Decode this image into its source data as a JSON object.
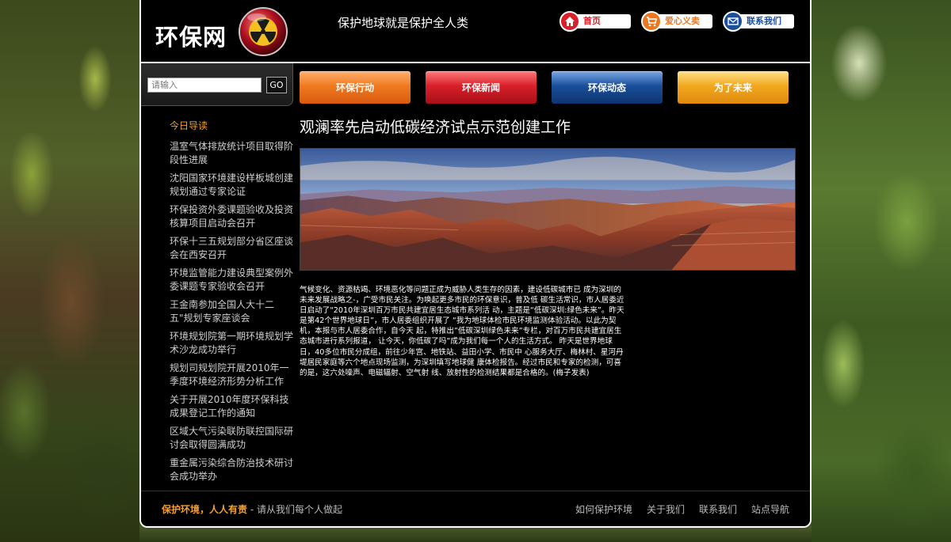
{
  "header": {
    "logo_text": "环保网",
    "slogan": "保护地球就是保护全人类",
    "topnav": [
      {
        "label": "首页",
        "icon": "home-icon",
        "color": "#d8202a"
      },
      {
        "label": "爱心义卖",
        "icon": "cart-icon",
        "color": "#e87822"
      },
      {
        "label": "联系我们",
        "icon": "mail-icon",
        "color": "#1a4f9a"
      }
    ]
  },
  "search": {
    "placeholder": "请输入",
    "button_label": "GO"
  },
  "mainnav": [
    {
      "label": "环保行动",
      "color": "#f07a20"
    },
    {
      "label": "环保新闻",
      "color": "#d8202a"
    },
    {
      "label": "环保动态",
      "color": "#1a4f9a"
    },
    {
      "label": "为了未来",
      "color": "#f2a81e"
    }
  ],
  "sidebar": {
    "title": "今日导读",
    "items": [
      "温室气体排放统计项目取得阶段性进展",
      "沈阳国家环境建设样板城创建规划通过专家论证",
      "环保投资外委课题验收及投资核算项目启动会召开",
      "环保十三五规划部分省区座谈会在西安召开",
      "环境监管能力建设典型案例外委课题专家验收会召开",
      "王金南参加全国人大十二五\"规划专家座谈会",
      "环境规划院第一期环境规划学术沙龙成功举行",
      "规划司规划院开展2010年一季度环境经济形势分析工作",
      "关于开展2010年度环保科技成果登记工作的通知",
      "区域大气污染联防联控国际研讨会取得圆满成功",
      "重金属污染综合防治技术研讨会成功举办"
    ]
  },
  "article": {
    "title": "观澜率先启动低碳经济试点示范创建工作",
    "body": "气候变化、资源枯竭、环境恶化等问题正成为威胁人类生存的因素，建设低碳城市已 成为深圳的未来发展战略之-，广受市民关注。为唤起更多市民的环保意识，普及低 碳生活常识，市人居委近日启动了\"2010年深圳百万市民共建宜居生态城市系列活 动，主题是“低碳深圳:绿色未来”。昨天是第42个世界地球日”，市人居委组织开展了 “我为地球体检市民环境监测体验活动。以此为契机，本报与市人居委合作，自今天 起，特推出”低碳深圳绿色未来”专栏，对百万市民共建宜居生态城市进行系列报道， 让今天，你低碳了吗”成为我们每一个人的生活方式。 昨天是世界地球日，40多位市民分成组，前往少年宫、地铁站、益田小学、市民中 心服务大厅、梅林村、星河丹堤居民家庭等六个地点现场监测，为深圳填写地球健 康体检报告。经过市民和专家的检测，可喜的是，这六处噪声、电磁辐射、空气射 线、放射性的检测结果都是合格的。(梅子发表)"
  },
  "footer": {
    "highlight": "保护环境，人人有责",
    "sub": " - 请从我们每个人做起",
    "links": [
      "如何保护环境",
      "关于我们",
      "联系我们",
      "站点导航"
    ]
  }
}
